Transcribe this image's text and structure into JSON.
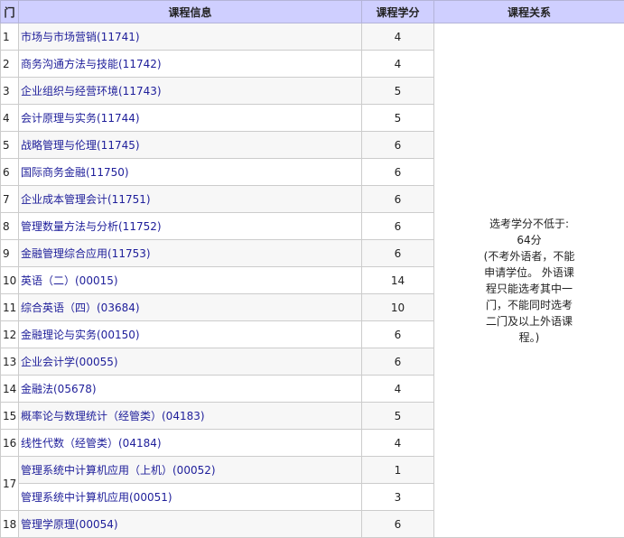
{
  "headers": {
    "num": "门",
    "info": "课程信息",
    "credit": "课程学分",
    "relation": "课程关系"
  },
  "courses": [
    {
      "num": "1",
      "name": "市场与市场营销(11741)",
      "credit": "4"
    },
    {
      "num": "2",
      "name": "商务沟通方法与技能(11742)",
      "credit": "4"
    },
    {
      "num": "3",
      "name": "企业组织与经营环境(11743)",
      "credit": "5"
    },
    {
      "num": "4",
      "name": "会计原理与实务(11744)",
      "credit": "5"
    },
    {
      "num": "5",
      "name": "战略管理与伦理(11745)",
      "credit": "6"
    },
    {
      "num": "6",
      "name": "国际商务金融(11750)",
      "credit": "6"
    },
    {
      "num": "7",
      "name": "企业成本管理会计(11751)",
      "credit": "6"
    },
    {
      "num": "8",
      "name": "管理数量方法与分析(11752)",
      "credit": "6"
    },
    {
      "num": "9",
      "name": "金融管理综合应用(11753)",
      "credit": "6"
    },
    {
      "num": "10",
      "name": "英语（二）(00015)",
      "credit": "14"
    },
    {
      "num": "11",
      "name": "综合英语（四）(03684)",
      "credit": "10"
    },
    {
      "num": "12",
      "name": "金融理论与实务(00150)",
      "credit": "6"
    },
    {
      "num": "13",
      "name": "企业会计学(00055)",
      "credit": "6"
    },
    {
      "num": "14",
      "name": "金融法(05678)",
      "credit": "4"
    },
    {
      "num": "15",
      "name": "概率论与数理统计（经管类）(04183)",
      "credit": "5"
    },
    {
      "num": "16",
      "name": "线性代数（经管类）(04184)",
      "credit": "4"
    },
    {
      "num": "17",
      "name": "管理系统中计算机应用（上机）(00052)",
      "credit": "1"
    },
    {
      "num": "",
      "name": "管理系统中计算机应用(00051)",
      "credit": "3"
    },
    {
      "num": "18",
      "name": "管理学原理(00054)",
      "credit": "6"
    }
  ],
  "relation": {
    "line1": "选考学分不低于:",
    "line2": "64分",
    "line3": "(不考外语者，不能",
    "line4": "申请学位。 外语课",
    "line5": "程只能选考其中一",
    "line6": "门，不能同时选考",
    "line7": "二门及以上外语课",
    "line8": "程。)"
  }
}
